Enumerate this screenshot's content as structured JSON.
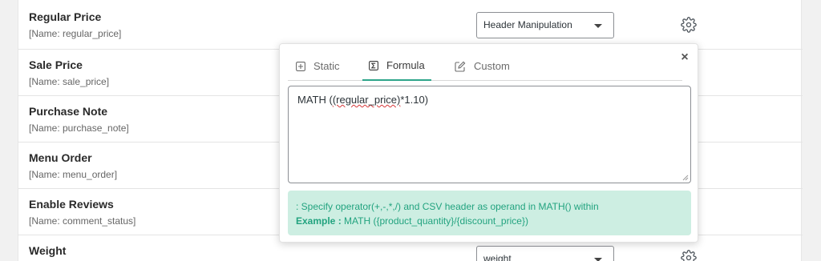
{
  "fields": [
    {
      "label": "Regular Price",
      "meta": "[Name: regular_price]"
    },
    {
      "label": "Sale Price",
      "meta": "[Name: sale_price]"
    },
    {
      "label": "Purchase Note",
      "meta": "[Name: purchase_note]"
    },
    {
      "label": "Menu Order",
      "meta": "[Name: menu_order]"
    },
    {
      "label": "Enable Reviews",
      "meta": "[Name: comment_status]"
    },
    {
      "label": "Weight",
      "meta": ""
    }
  ],
  "selects": {
    "regular_price": "Header Manipulation",
    "weight": "weight"
  },
  "popup": {
    "tabs": [
      {
        "label": "Static",
        "icon": "plus-square-icon"
      },
      {
        "label": "Formula",
        "icon": "sigma-icon"
      },
      {
        "label": "Custom",
        "icon": "edit-icon"
      }
    ],
    "active_tab": "Formula",
    "close_label": "×",
    "formula": {
      "prefix": "MATH (",
      "token": "(regular_price)",
      "suffix": "*1.10)"
    },
    "help": {
      "line1": ": Specify operator(+,-,*,/) and CSV header as operand in MATH() within",
      "example_label": "Example :",
      "example_value": " MATH ({product_quantity}/{discount_price})"
    }
  },
  "colors": {
    "accent": "#2da58a",
    "help_bg": "#cdeee2",
    "help_text": "#22a37f"
  }
}
